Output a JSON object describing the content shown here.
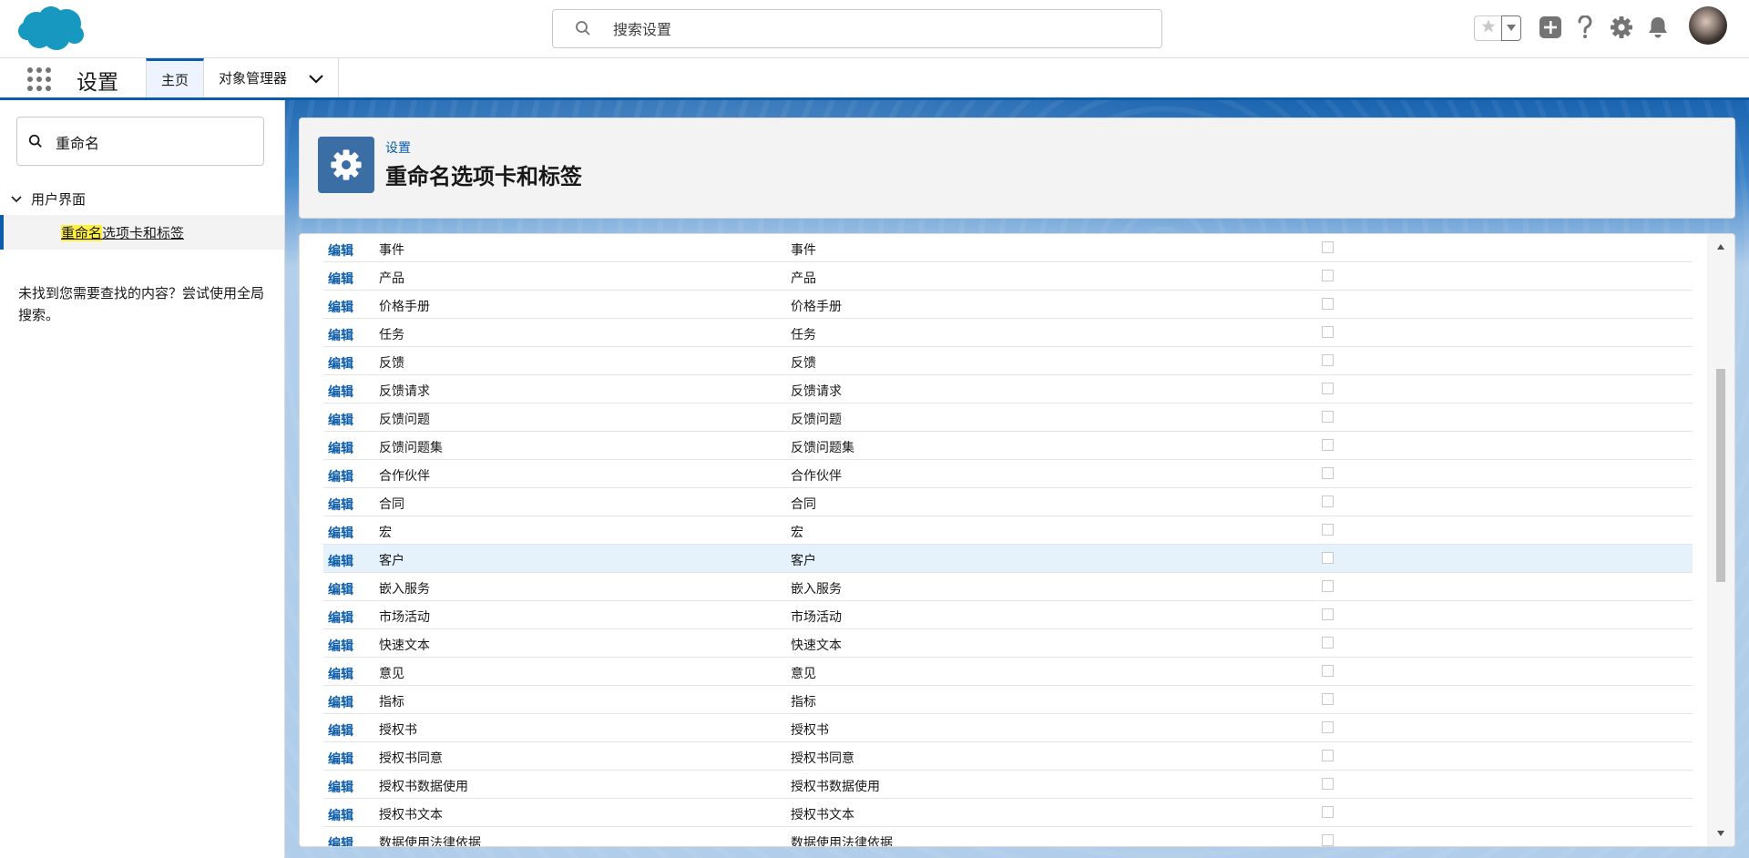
{
  "header": {
    "search_placeholder": "搜索设置"
  },
  "app_nav": {
    "app_name": "设置",
    "tabs": [
      {
        "label": "主页"
      },
      {
        "label": "对象管理器"
      }
    ]
  },
  "sidebar": {
    "quickfind_value": "重命名",
    "group_label": "用户界面",
    "item_highlight": "重命名",
    "item_rest": "选项卡和标签",
    "help_text": "未找到您需要查找的内容？尝试使用全局搜索。"
  },
  "page": {
    "breadcrumb": "设置",
    "title": "重命名选项卡和标签"
  },
  "table": {
    "edit_label": "编辑",
    "highlighted_row": 11,
    "rows": [
      {
        "label": "事件",
        "plural": "事件"
      },
      {
        "label": "产品",
        "plural": "产品"
      },
      {
        "label": "价格手册",
        "plural": "价格手册"
      },
      {
        "label": "任务",
        "plural": "任务"
      },
      {
        "label": "反馈",
        "plural": "反馈"
      },
      {
        "label": "反馈请求",
        "plural": "反馈请求"
      },
      {
        "label": "反馈问题",
        "plural": "反馈问题"
      },
      {
        "label": "反馈问题集",
        "plural": "反馈问题集"
      },
      {
        "label": "合作伙伴",
        "plural": "合作伙伴"
      },
      {
        "label": "合同",
        "plural": "合同"
      },
      {
        "label": "宏",
        "plural": "宏"
      },
      {
        "label": "客户",
        "plural": "客户"
      },
      {
        "label": "嵌入服务",
        "plural": "嵌入服务"
      },
      {
        "label": "市场活动",
        "plural": "市场活动"
      },
      {
        "label": "快速文本",
        "plural": "快速文本"
      },
      {
        "label": "意见",
        "plural": "意见"
      },
      {
        "label": "指标",
        "plural": "指标"
      },
      {
        "label": "授权书",
        "plural": "授权书"
      },
      {
        "label": "授权书同意",
        "plural": "授权书同意"
      },
      {
        "label": "授权书数据使用",
        "plural": "授权书数据使用"
      },
      {
        "label": "授权书文本",
        "plural": "授权书文本"
      },
      {
        "label": "数据使用法律依据",
        "plural": "数据使用法律依据"
      }
    ]
  },
  "colors": {
    "brand": "#0b5cab",
    "cloud": "#1798c1"
  }
}
